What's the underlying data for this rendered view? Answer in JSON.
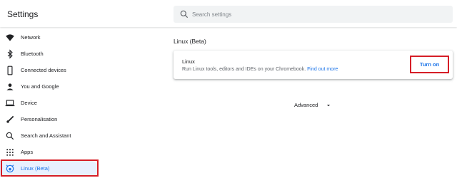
{
  "header": {
    "title": "Settings",
    "search_placeholder": "Search settings",
    "search_icon": "search-icon"
  },
  "sidebar": {
    "items": [
      {
        "label": "Network",
        "icon": "wifi-icon"
      },
      {
        "label": "Bluetooth",
        "icon": "bluetooth-icon"
      },
      {
        "label": "Connected devices",
        "icon": "phone-icon"
      },
      {
        "label": "You and Google",
        "icon": "person-icon"
      },
      {
        "label": "Device",
        "icon": "laptop-icon"
      },
      {
        "label": "Personalisation",
        "icon": "brush-icon"
      },
      {
        "label": "Search and Assistant",
        "icon": "search-icon"
      },
      {
        "label": "Apps",
        "icon": "apps-grid-icon"
      },
      {
        "label": "Linux (Beta)",
        "icon": "linux-penguin-icon",
        "active": true
      }
    ]
  },
  "main": {
    "section_title": "Linux (Beta)",
    "card": {
      "title": "Linux",
      "description": "Run Linux tools, editors and IDEs on your Chromebook.",
      "link": "Find out more",
      "button": "Turn on"
    },
    "advanced_label": "Advanced"
  },
  "colors": {
    "accent": "#1a73e8",
    "highlight": "#d61e27",
    "active_bg": "#e8f0fe"
  }
}
